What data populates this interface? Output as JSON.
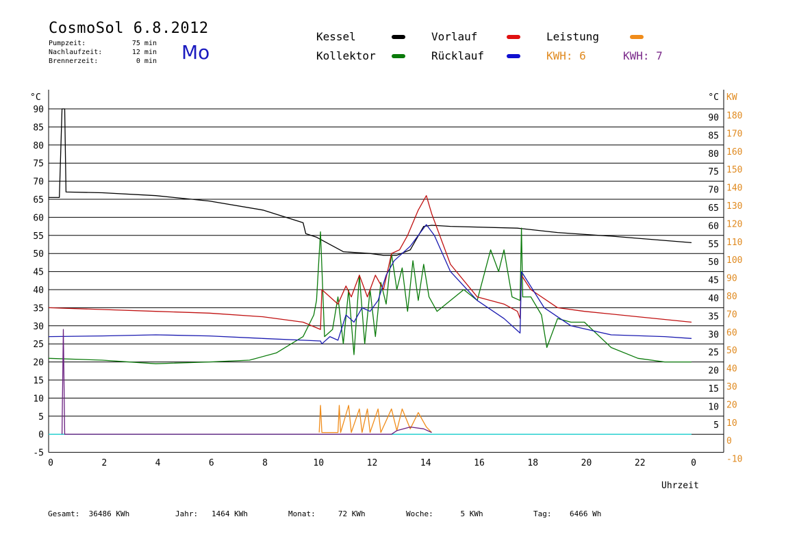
{
  "header": {
    "title": "CosmoSol 6.8.2012",
    "day": "Mo",
    "stats": [
      {
        "label": "Pumpzeit:",
        "value": "75 min"
      },
      {
        "label": "Nachlaufzeit:",
        "value": "12 min"
      },
      {
        "label": "Brennerzeit:",
        "value": "0 min"
      }
    ]
  },
  "legend": {
    "kessel": {
      "label": "Kessel",
      "color": "#000000"
    },
    "kollektor": {
      "label": "Kollektor",
      "color": "#0a7a0a"
    },
    "vorlauf": {
      "label": "Vorlauf",
      "color": "#e01010"
    },
    "ruecklauf": {
      "label": "Rücklauf",
      "color": "#1010d0"
    },
    "leistung": {
      "label": "Leistung",
      "color": "#f08c1a"
    },
    "kwh1": {
      "label": "KWH: 6",
      "color": "#e08a20"
    },
    "kwh2": {
      "label": "KWH: 7",
      "color": "#7a2a8a"
    }
  },
  "footer": [
    {
      "label": "Gesamt:",
      "value": "36486 KWh"
    },
    {
      "label": "Jahr:",
      "value": "1464 KWh"
    },
    {
      "label": "Monat:",
      "value": "72 KWh"
    },
    {
      "label": "Woche:",
      "value": "5 KWh"
    },
    {
      "label": "Tag:",
      "value": "6466 Wh"
    }
  ],
  "chart_data": {
    "type": "line",
    "xlabel": "Uhrzeit",
    "ylabel_left": "°C",
    "ylabel_right_temp": "°C",
    "ylabel_right_power": "KW",
    "xlim": [
      0,
      24
    ],
    "ylim": [
      -5,
      95
    ],
    "grid": true,
    "x_ticks": [
      "0",
      "2",
      "4",
      "6",
      "8",
      "10",
      "12",
      "14",
      "16",
      "18",
      "20",
      "22",
      "0"
    ],
    "y_ticks_left": [
      "90",
      "85",
      "80",
      "75",
      "70",
      "65",
      "60",
      "55",
      "50",
      "45",
      "40",
      "35",
      "30",
      "25",
      "20",
      "15",
      "10",
      "5",
      "0",
      "-5"
    ],
    "y_ticks_right_temp": [
      "°C",
      "90",
      "85",
      "80",
      "75",
      "70",
      "65",
      "60",
      "55",
      "50",
      "45",
      "40",
      "35",
      "30",
      "25",
      "20",
      "15",
      "10",
      "5"
    ],
    "y_ticks_right_power": [
      "KW",
      "180",
      "170",
      "160",
      "150",
      "140",
      "130",
      "120",
      "110",
      "100",
      "90",
      "80",
      "70",
      "60",
      "50",
      "40",
      "30",
      "20",
      "10",
      "0",
      "-10"
    ],
    "series": [
      {
        "name": "Kessel",
        "color": "#000000",
        "points": [
          [
            0,
            65.5
          ],
          [
            0.4,
            65.5
          ],
          [
            0.5,
            90
          ],
          [
            0.6,
            90
          ],
          [
            0.65,
            67
          ],
          [
            2,
            66.8
          ],
          [
            4,
            66
          ],
          [
            6,
            64.5
          ],
          [
            8,
            62
          ],
          [
            9.5,
            58.5
          ],
          [
            9.6,
            55.5
          ],
          [
            10,
            54.5
          ],
          [
            11,
            50.5
          ],
          [
            12,
            50
          ],
          [
            12.5,
            49.5
          ],
          [
            13,
            49.5
          ],
          [
            13.5,
            51
          ],
          [
            14,
            57.5
          ],
          [
            14.3,
            57.8
          ],
          [
            15,
            57.5
          ],
          [
            17.5,
            57
          ],
          [
            19,
            55.8
          ],
          [
            21,
            54.8
          ],
          [
            24,
            53
          ]
        ]
      },
      {
        "name": "Kollektor",
        "color": "#0a7a0a",
        "points": [
          [
            0,
            21
          ],
          [
            2,
            20.5
          ],
          [
            4,
            19.5
          ],
          [
            6,
            20
          ],
          [
            7.5,
            20.5
          ],
          [
            8.5,
            22.5
          ],
          [
            9.5,
            27
          ],
          [
            9.9,
            33
          ],
          [
            10,
            37
          ],
          [
            10.15,
            56
          ],
          [
            10.3,
            27
          ],
          [
            10.6,
            29
          ],
          [
            10.8,
            38
          ],
          [
            11.0,
            25
          ],
          [
            11.2,
            40
          ],
          [
            11.4,
            22
          ],
          [
            11.6,
            44
          ],
          [
            11.8,
            25
          ],
          [
            12,
            40
          ],
          [
            12.2,
            27
          ],
          [
            12.4,
            42
          ],
          [
            12.6,
            36
          ],
          [
            12.8,
            50
          ],
          [
            13.0,
            40
          ],
          [
            13.2,
            46
          ],
          [
            13.4,
            34
          ],
          [
            13.6,
            48
          ],
          [
            13.8,
            37
          ],
          [
            14.0,
            47
          ],
          [
            14.2,
            38
          ],
          [
            14.5,
            34
          ],
          [
            15.5,
            40
          ],
          [
            16,
            37
          ],
          [
            16.5,
            51
          ],
          [
            16.8,
            45
          ],
          [
            17,
            51
          ],
          [
            17.3,
            38
          ],
          [
            17.6,
            37
          ],
          [
            17.65,
            57
          ],
          [
            17.7,
            38
          ],
          [
            18,
            38
          ],
          [
            18.4,
            33
          ],
          [
            18.6,
            24
          ],
          [
            19,
            32
          ],
          [
            19.5,
            31
          ],
          [
            20,
            31
          ],
          [
            21,
            24
          ],
          [
            22,
            21
          ],
          [
            23,
            20
          ],
          [
            24,
            20
          ]
        ]
      },
      {
        "name": "Vorlauf",
        "color": "#c01010",
        "points": [
          [
            0,
            35
          ],
          [
            2,
            34.5
          ],
          [
            4,
            34
          ],
          [
            6,
            33.5
          ],
          [
            8,
            32.5
          ],
          [
            9.5,
            31
          ],
          [
            10.15,
            29
          ],
          [
            10.2,
            40
          ],
          [
            10.8,
            36
          ],
          [
            11.1,
            41
          ],
          [
            11.3,
            38
          ],
          [
            11.6,
            44
          ],
          [
            11.9,
            38
          ],
          [
            12.2,
            44
          ],
          [
            12.5,
            40
          ],
          [
            12.8,
            50
          ],
          [
            13.1,
            51
          ],
          [
            13.4,
            55
          ],
          [
            13.8,
            62
          ],
          [
            14.1,
            66
          ],
          [
            14.3,
            61
          ],
          [
            15,
            47
          ],
          [
            16,
            38
          ],
          [
            17,
            36
          ],
          [
            17.5,
            34
          ],
          [
            17.6,
            32
          ],
          [
            17.65,
            44
          ],
          [
            18,
            40
          ],
          [
            19,
            35
          ],
          [
            20,
            34
          ],
          [
            22,
            32.5
          ],
          [
            24,
            31
          ]
        ]
      },
      {
        "name": "Rücklauf",
        "color": "#1a1ab0",
        "points": [
          [
            0,
            27
          ],
          [
            2,
            27.2
          ],
          [
            4,
            27.5
          ],
          [
            6,
            27.2
          ],
          [
            8,
            26.5
          ],
          [
            9.5,
            26
          ],
          [
            10.15,
            25.8
          ],
          [
            10.2,
            25
          ],
          [
            10.5,
            27
          ],
          [
            10.8,
            26
          ],
          [
            11.1,
            33
          ],
          [
            11.4,
            31
          ],
          [
            11.7,
            35
          ],
          [
            12,
            34
          ],
          [
            12.3,
            37
          ],
          [
            12.6,
            44
          ],
          [
            12.9,
            48
          ],
          [
            13.2,
            50
          ],
          [
            13.5,
            52
          ],
          [
            13.8,
            55
          ],
          [
            14.1,
            58
          ],
          [
            14.4,
            55
          ],
          [
            15,
            45
          ],
          [
            16,
            37
          ],
          [
            17,
            32
          ],
          [
            17.6,
            28
          ],
          [
            17.65,
            45
          ],
          [
            18.5,
            35
          ],
          [
            19.5,
            30
          ],
          [
            21,
            27.5
          ],
          [
            23,
            27
          ],
          [
            24,
            26.5
          ]
        ]
      },
      {
        "name": "Leistung",
        "color": "#f08c1a",
        "points": [
          [
            10.1,
            0.5
          ],
          [
            10.15,
            8
          ],
          [
            10.2,
            0.5
          ],
          [
            10.8,
            0.5
          ],
          [
            10.85,
            8
          ],
          [
            10.9,
            0.5
          ],
          [
            11.2,
            8
          ],
          [
            11.3,
            0.5
          ],
          [
            11.6,
            7
          ],
          [
            11.7,
            0.5
          ],
          [
            11.9,
            7
          ],
          [
            12,
            0.5
          ],
          [
            12.3,
            7
          ],
          [
            12.4,
            0.5
          ],
          [
            12.8,
            7
          ],
          [
            13,
            1
          ],
          [
            13.2,
            7
          ],
          [
            13.5,
            1.5
          ],
          [
            13.8,
            6
          ],
          [
            14.1,
            2
          ],
          [
            14.3,
            0.5
          ]
        ]
      },
      {
        "name": "KWH: 7",
        "color": "#6a2080",
        "points": [
          [
            0.5,
            0
          ],
          [
            0.55,
            29
          ],
          [
            0.6,
            0
          ],
          [
            12.8,
            0
          ],
          [
            13,
            1
          ],
          [
            13.5,
            2
          ],
          [
            14,
            1.5
          ],
          [
            14.3,
            0.5
          ]
        ]
      }
    ]
  }
}
